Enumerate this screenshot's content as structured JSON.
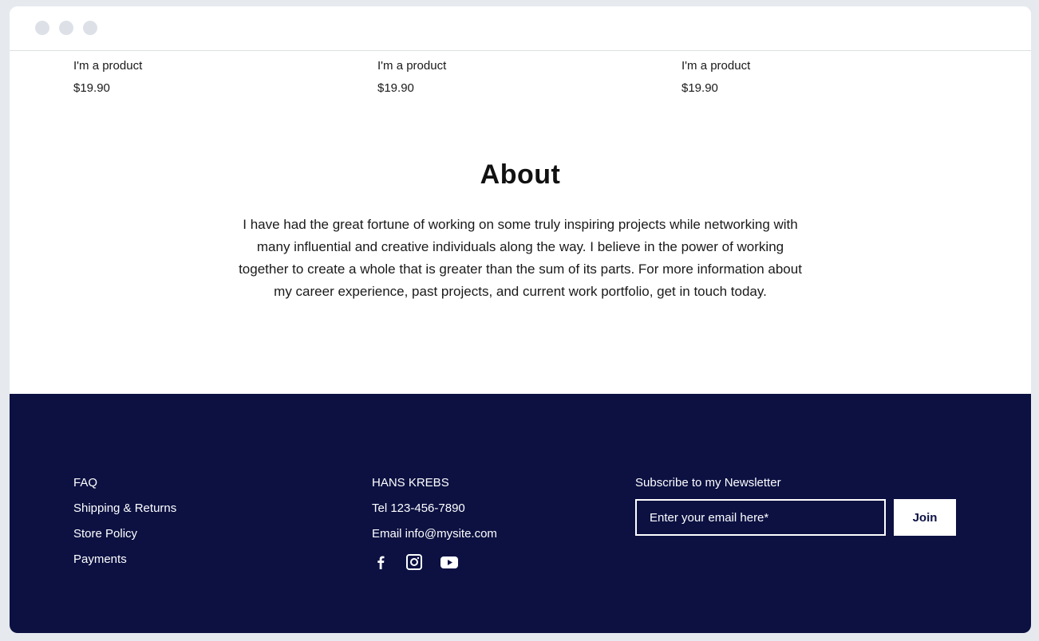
{
  "products": [
    {
      "name": "I'm a product",
      "price": "$19.90"
    },
    {
      "name": "I'm a product",
      "price": "$19.90"
    },
    {
      "name": "I'm a product",
      "price": "$19.90"
    }
  ],
  "about": {
    "title": "About",
    "text": "I have had the great fortune of working on some truly inspiring projects while networking with many influential and creative individuals along the way. I believe in the power of working together to create a whole that is greater than the sum of its parts. For more information about my career experience, past projects, and current work portfolio, get in touch today."
  },
  "footer": {
    "links": [
      "FAQ",
      "Shipping & Returns",
      "Store Policy",
      "Payments"
    ],
    "contact": {
      "name": "HANS KREBS",
      "tel": "Tel 123-456-7890",
      "email": "Email info@mysite.com"
    },
    "social": [
      "facebook-icon",
      "instagram-icon",
      "youtube-icon"
    ],
    "newsletter": {
      "label": "Subscribe to my Newsletter",
      "placeholder": "Enter your email here*",
      "button": "Join"
    }
  },
  "colors": {
    "footer_bg": "#0c1142",
    "page_bg": "#ffffff",
    "text": "#1a1a1a"
  }
}
